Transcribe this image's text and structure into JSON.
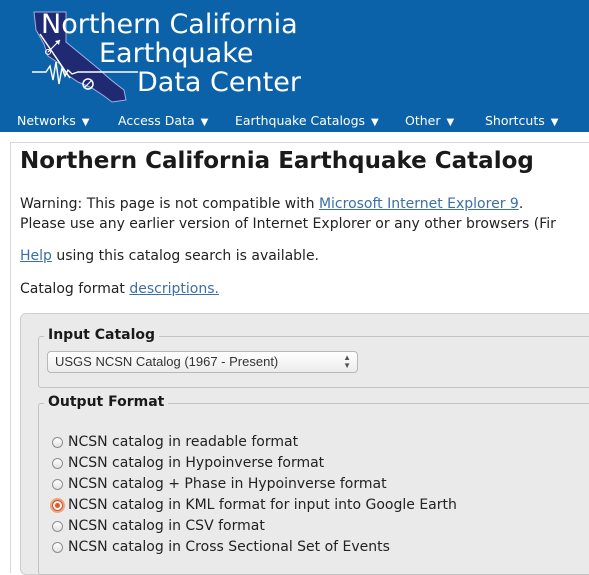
{
  "header": {
    "title_lines": [
      "Northern California",
      "Earthquake",
      "Data Center"
    ],
    "logo_icon": "california-seismograph-logo-icon",
    "bg_color": "#0c62a8"
  },
  "nav": {
    "items": [
      {
        "label": "Networks",
        "caret": "▼"
      },
      {
        "label": "Access Data",
        "caret": "▼"
      },
      {
        "label": "Earthquake Catalogs",
        "caret": "▼"
      },
      {
        "label": "Other",
        "caret": "▼"
      },
      {
        "label": "Shortcuts",
        "caret": "▼"
      }
    ]
  },
  "page": {
    "heading": "Northern California Earthquake Catalog",
    "warning_prefix": "Warning: This page is not compatible with ",
    "warning_link": "Microsoft Internet Explorer 9",
    "warning_suffix": ".",
    "warning_line2": "Please use any earlier version of Internet Explorer or any other browsers (Fir",
    "help_link": "Help",
    "help_text": " using this catalog search is available.",
    "format_text": "Catalog format ",
    "format_link": "descriptions."
  },
  "form": {
    "input_catalog": {
      "legend": "Input Catalog",
      "selected": "USGS NCSN Catalog (1967 - Present)"
    },
    "output_format": {
      "legend": "Output Format",
      "options": [
        {
          "label": "NCSN catalog in readable format",
          "checked": false
        },
        {
          "label": "NCSN catalog in Hypoinverse format",
          "checked": false
        },
        {
          "label": "NCSN catalog + Phase in Hypoinverse format",
          "checked": false
        },
        {
          "label": "NCSN catalog in KML format for input into Google Earth",
          "checked": true
        },
        {
          "label": "NCSN catalog in CSV format",
          "checked": false
        },
        {
          "label": "NCSN catalog in Cross Sectional Set of Events",
          "checked": false
        }
      ]
    }
  }
}
